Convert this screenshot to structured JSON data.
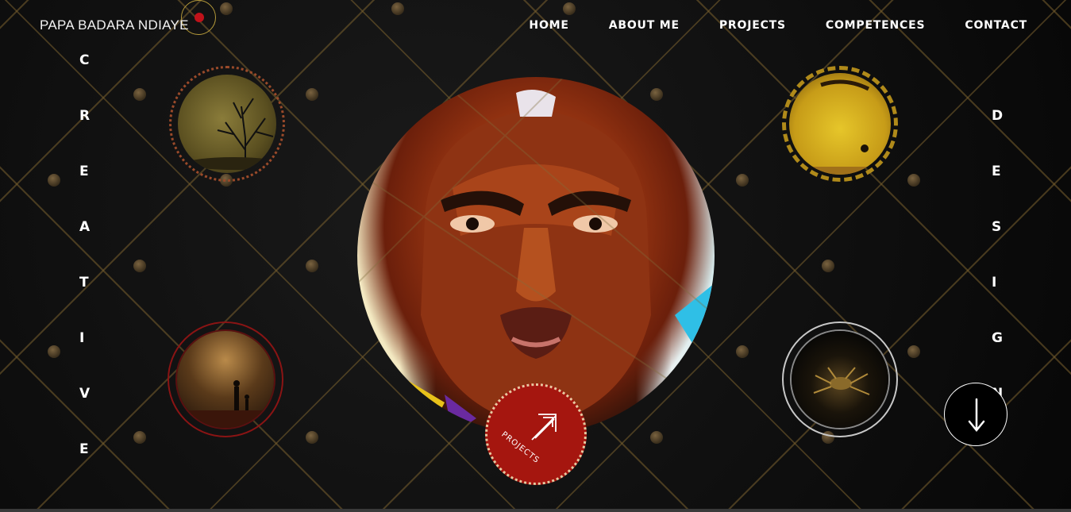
{
  "header": {
    "brand": "PAPA BADARA NDIAYE"
  },
  "nav": {
    "items": [
      {
        "label": "HOME"
      },
      {
        "label": "ABOUT ME"
      },
      {
        "label": "PROJECTS"
      },
      {
        "label": "COMPETENCES"
      },
      {
        "label": "CONTACT"
      }
    ]
  },
  "left_word": [
    "C",
    "R",
    "E",
    "A",
    "T",
    "I",
    "V",
    "E"
  ],
  "right_word": [
    "D",
    "E",
    "S",
    "I",
    "G",
    "N"
  ],
  "projects_badge": {
    "label": "PROJECTS",
    "icon": "arrow-up-right-icon"
  },
  "scroll_button": {
    "icon": "arrow-down-icon"
  },
  "colors": {
    "accent_red": "#a5160f",
    "gold": "#b59a3a",
    "background": "#0b0b0b"
  }
}
